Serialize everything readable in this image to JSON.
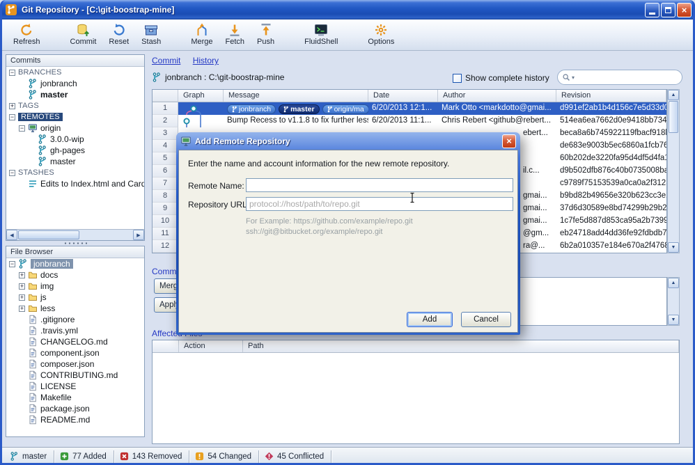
{
  "window": {
    "title": "Git Repository - [C:\\git-boostrap-mine]"
  },
  "toolbar": [
    {
      "label": "Refresh",
      "icon": "refresh",
      "group": 0
    },
    {
      "label": "Commit",
      "icon": "commit",
      "group": 1
    },
    {
      "label": "Reset",
      "icon": "reset",
      "group": 1
    },
    {
      "label": "Stash",
      "icon": "stash",
      "group": 1
    },
    {
      "label": "Merge",
      "icon": "merge",
      "group": 2
    },
    {
      "label": "Fetch",
      "icon": "fetch",
      "group": 2
    },
    {
      "label": "Push",
      "icon": "push",
      "group": 2
    },
    {
      "label": "FluidShell",
      "icon": "fluidshell",
      "group": 3
    },
    {
      "label": "Options",
      "icon": "options",
      "group": 4
    }
  ],
  "commits_panel": {
    "title": "Commits",
    "tree": [
      {
        "label": "BRANCHES",
        "level": 0,
        "icon": "none",
        "expander": "minus",
        "kind": "section"
      },
      {
        "label": "jonbranch",
        "level": 1,
        "icon": "branch",
        "expander": "none",
        "kind": "item"
      },
      {
        "label": "master",
        "level": 1,
        "icon": "branch",
        "expander": "none",
        "kind": "item",
        "bold": true
      },
      {
        "label": "TAGS",
        "level": 0,
        "icon": "none",
        "expander": "plus",
        "kind": "section"
      },
      {
        "label": "REMOTES",
        "level": 0,
        "icon": "none",
        "expander": "minus",
        "kind": "section",
        "selected": true
      },
      {
        "label": "origin",
        "level": 1,
        "icon": "remote",
        "expander": "minus",
        "kind": "item"
      },
      {
        "label": "3.0.0-wip",
        "level": 2,
        "icon": "branch",
        "expander": "none",
        "kind": "item"
      },
      {
        "label": "gh-pages",
        "level": 2,
        "icon": "branch",
        "expander": "none",
        "kind": "item"
      },
      {
        "label": "master",
        "level": 2,
        "icon": "branch",
        "expander": "none",
        "kind": "item"
      },
      {
        "label": "STASHES",
        "level": 0,
        "icon": "none",
        "expander": "minus",
        "kind": "section"
      },
      {
        "label": "Edits to Index.html and Card",
        "level": 1,
        "icon": "stash-list",
        "expander": "none",
        "kind": "item"
      }
    ]
  },
  "file_browser": {
    "title": "File Browser",
    "tree": [
      {
        "label": "jonbranch",
        "level": 0,
        "icon": "branch",
        "expander": "minus",
        "kind": "item",
        "selected": true
      },
      {
        "label": "docs",
        "level": 1,
        "icon": "folder",
        "expander": "plus",
        "kind": "item"
      },
      {
        "label": "img",
        "level": 1,
        "icon": "folder",
        "expander": "plus",
        "kind": "item"
      },
      {
        "label": "js",
        "level": 1,
        "icon": "folder",
        "expander": "plus",
        "kind": "item"
      },
      {
        "label": "less",
        "level": 1,
        "icon": "folder",
        "expander": "plus",
        "kind": "item"
      },
      {
        "label": ".gitignore",
        "level": 1,
        "icon": "file",
        "expander": "none",
        "kind": "item"
      },
      {
        "label": ".travis.yml",
        "level": 1,
        "icon": "file",
        "expander": "none",
        "kind": "item"
      },
      {
        "label": "CHANGELOG.md",
        "level": 1,
        "icon": "file",
        "expander": "none",
        "kind": "item"
      },
      {
        "label": "component.json",
        "level": 1,
        "icon": "file",
        "expander": "none",
        "kind": "item"
      },
      {
        "label": "composer.json",
        "level": 1,
        "icon": "file",
        "expander": "none",
        "kind": "item"
      },
      {
        "label": "CONTRIBUTING.md",
        "level": 1,
        "icon": "file",
        "expander": "none",
        "kind": "item"
      },
      {
        "label": "LICENSE",
        "level": 1,
        "icon": "file",
        "expander": "none",
        "kind": "item"
      },
      {
        "label": "Makefile",
        "level": 1,
        "icon": "file",
        "expander": "none",
        "kind": "item"
      },
      {
        "label": "package.json",
        "level": 1,
        "icon": "file",
        "expander": "none",
        "kind": "item"
      },
      {
        "label": "README.md",
        "level": 1,
        "icon": "file",
        "expander": "none",
        "kind": "item"
      }
    ]
  },
  "history": {
    "tabs": [
      {
        "label": "Commit"
      },
      {
        "label": "History"
      }
    ],
    "branch_label": "jonbranch : C:\\git-boostrap-mine",
    "show_complete_history_label": "Show complete history",
    "search_value": "",
    "columns": [
      "",
      "Graph",
      "Message",
      "Date",
      "Author",
      "Revision"
    ],
    "rows": [
      {
        "num": "1",
        "graph": "merge",
        "badges": [
          "jonbranch",
          "master",
          "origin/ma"
        ],
        "message": "",
        "date": "6/20/2013 12:1...",
        "author": "Mark Otto <markdotto@gmai...",
        "revision": "d991ef2ab1b4d156c7e5d33d05...",
        "selected": true
      },
      {
        "num": "2",
        "graph": "line",
        "message": "Bump Recess to v1.1.8 to fix further less...",
        "date": "6/20/2013 11:1...",
        "author": "Chris Rebert <github@rebert...",
        "revision": "514ea6ea7662d0e9418bb7348..."
      },
      {
        "num": "3",
        "author_frag": "ebert...",
        "revision": "beca8a6b745922119fbacf918b..."
      },
      {
        "num": "4",
        "revision": "de683e9003b5ec6860a1fcb768..."
      },
      {
        "num": "5",
        "revision": "60b202de3220fa95d4df5d4fa1..."
      },
      {
        "num": "6",
        "author_frag": "il.c...",
        "revision": "d9b502dfb876c40b0735008bac..."
      },
      {
        "num": "7",
        "revision": "c9789f75153539a0ca0a2f3123..."
      },
      {
        "num": "8",
        "author_frag": "gmai...",
        "revision": "b9bd82b49656e320b623cc3e2c..."
      },
      {
        "num": "9",
        "author_frag": "gmai...",
        "revision": "37d6d30589e8bd74299b29b2..."
      },
      {
        "num": "10",
        "author_frag": "gmai...",
        "revision": "1c7fe5d887d853ca95a2b7399d..."
      },
      {
        "num": "11",
        "author_frag": "@gm...",
        "revision": "eb24718add4dd36fe92fdbdb79..."
      },
      {
        "num": "12",
        "author_frag": "ra@...",
        "revision": "6b2a010357e184e670a2f4768e..."
      }
    ]
  },
  "commit_section": {
    "title": "Commit",
    "buttons": [
      "Merge",
      "Apply"
    ]
  },
  "affected_files": {
    "title": "Affected Files",
    "columns": [
      "Action",
      "Path"
    ]
  },
  "dialog": {
    "title": "Add Remote Repository",
    "instruction": "Enter the name and account information for the new remote repository.",
    "remote_name_label": "Remote Name:",
    "remote_name_value": "",
    "repo_url_label": "Repository URL:",
    "repo_url_placeholder": "protocol://host/path/to/repo.git",
    "example_line1": "For Example: https://github.com/example/repo.git",
    "example_line2": "ssh://git@bitbucket.org/example/repo.git",
    "add_label": "Add",
    "cancel_label": "Cancel"
  },
  "statusbar": [
    {
      "label": "master",
      "icon": "branch"
    },
    {
      "label": "77 Added",
      "icon": "added"
    },
    {
      "label": "143 Removed",
      "icon": "removed"
    },
    {
      "label": "54 Changed",
      "icon": "changed"
    },
    {
      "label": "45 Conflicted",
      "icon": "conflicted"
    }
  ],
  "colors": {
    "titlebar_blue": "#2056c4",
    "selection_blue": "#2e5fc4",
    "accent_orange": "#e8941e",
    "badge_navy": "#0e2a6e"
  }
}
